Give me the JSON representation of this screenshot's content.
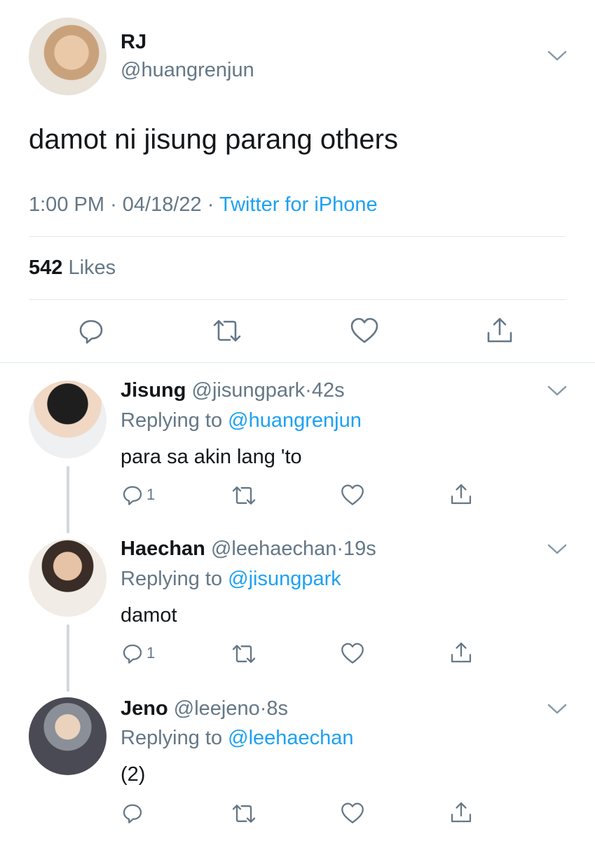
{
  "main_tweet": {
    "display_name": "RJ",
    "handle": "@huangrenjun",
    "text": "damot ni jisung parang others",
    "time": "1:00 PM",
    "date": "04/18/22",
    "source": "Twitter for iPhone",
    "likes_count": "542",
    "likes_label": "Likes"
  },
  "replies": [
    {
      "display_name": "Jisung",
      "handle": "@jisungpark",
      "time": "42s",
      "replying_label": "Replying to",
      "replying_to": "@huangrenjun",
      "text": "para sa akin lang 'to",
      "reply_count": "1"
    },
    {
      "display_name": "Haechan",
      "handle": "@leehaechan",
      "time": "19s",
      "replying_label": "Replying to",
      "replying_to": "@jisungpark",
      "text": "damot",
      "reply_count": "1"
    },
    {
      "display_name": "Jeno",
      "handle": "@leejeno",
      "time": "8s",
      "replying_label": "Replying to",
      "replying_to": "@leehaechan",
      "text": "(2)",
      "reply_count": ""
    }
  ],
  "separator": "·",
  "icons": [
    "chevron-down-icon",
    "reply-icon",
    "retweet-icon",
    "like-icon",
    "share-icon"
  ],
  "colors": {
    "link": "#1da1f2",
    "muted": "#657786",
    "text": "#14171a",
    "divider": "#e1e8ed"
  }
}
